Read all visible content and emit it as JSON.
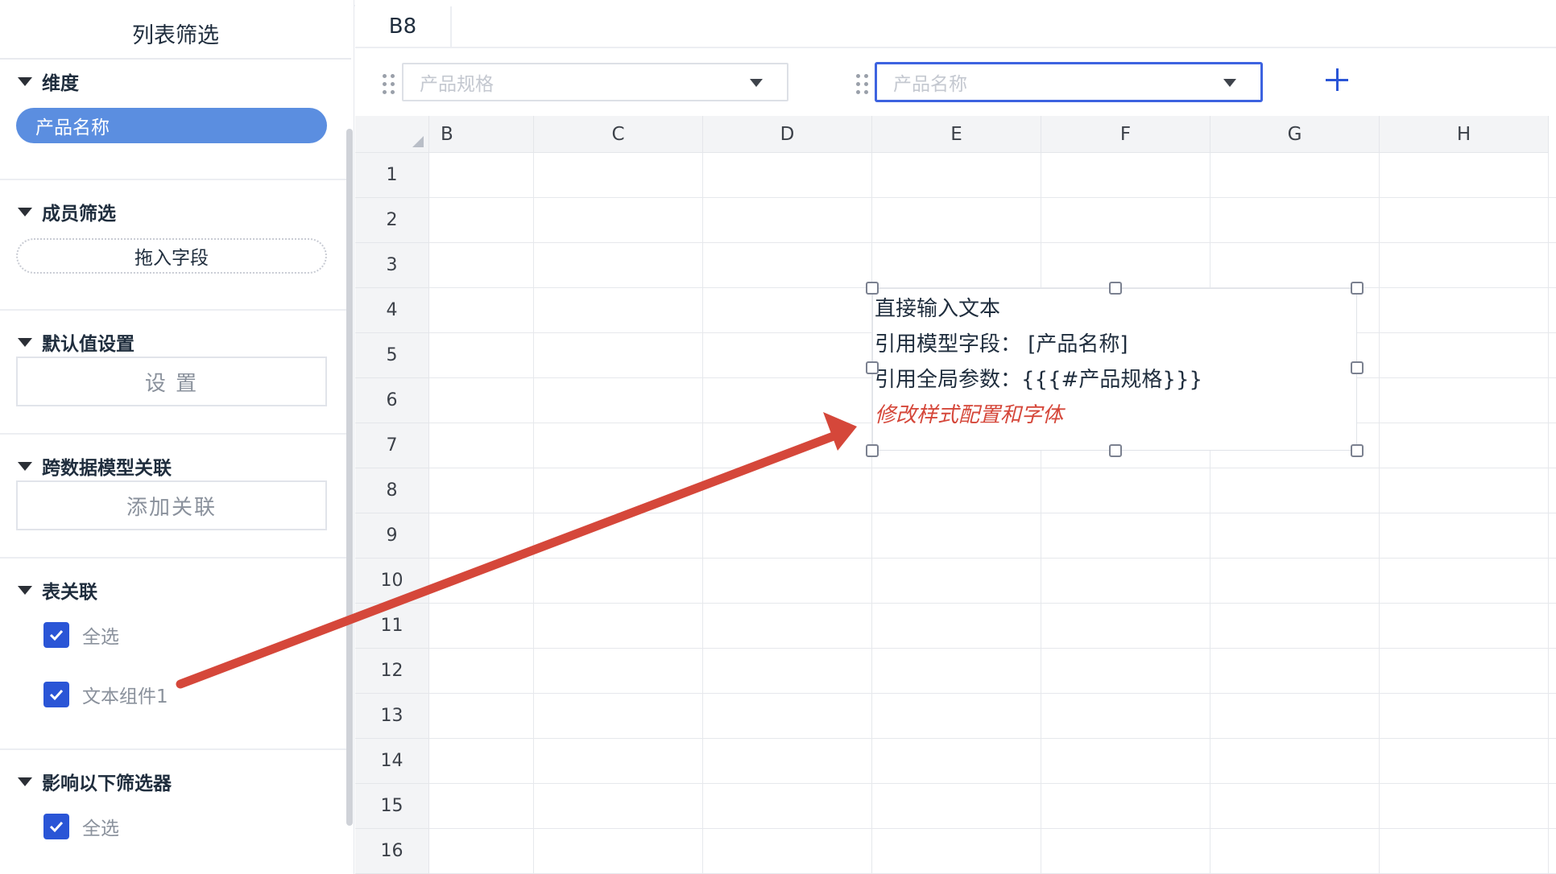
{
  "panel": {
    "title": "列表筛选",
    "sections": {
      "dimension": {
        "title": "维度",
        "chip": "产品名称"
      },
      "member_filter": {
        "title": "成员筛选",
        "drop_zone": "拖入字段"
      },
      "default_value": {
        "title": "默认值设置",
        "button": "设 置"
      },
      "cross_model": {
        "title": "跨数据模型关联",
        "button": "添加关联"
      },
      "table_link": {
        "title": "表关联",
        "items": [
          "全选",
          "文本组件1"
        ]
      },
      "affect_filters": {
        "title": "影响以下筛选器",
        "items": [
          "全选"
        ]
      }
    }
  },
  "sheet": {
    "cell_ref": "B8",
    "filters": [
      {
        "placeholder": "产品规格",
        "active": false
      },
      {
        "placeholder": "产品名称",
        "active": true
      }
    ],
    "columns": [
      "B",
      "C",
      "D",
      "E",
      "F",
      "G",
      "H"
    ],
    "rows": [
      "1",
      "2",
      "3",
      "4",
      "5",
      "6",
      "7",
      "8",
      "9",
      "10",
      "11",
      "12",
      "13",
      "14",
      "15",
      "16"
    ]
  },
  "text_component": {
    "lines": [
      "直接输入文本",
      "引用模型字段：  [产品名称]",
      "引用全局参数：{{{#产品规格}}}",
      "修改样式配置和字体"
    ]
  },
  "colors": {
    "accent": "#2a55d6",
    "chip": "#5b8ee0",
    "annotation_arrow": "#d5473a",
    "highlight_text": "#d5473a"
  }
}
